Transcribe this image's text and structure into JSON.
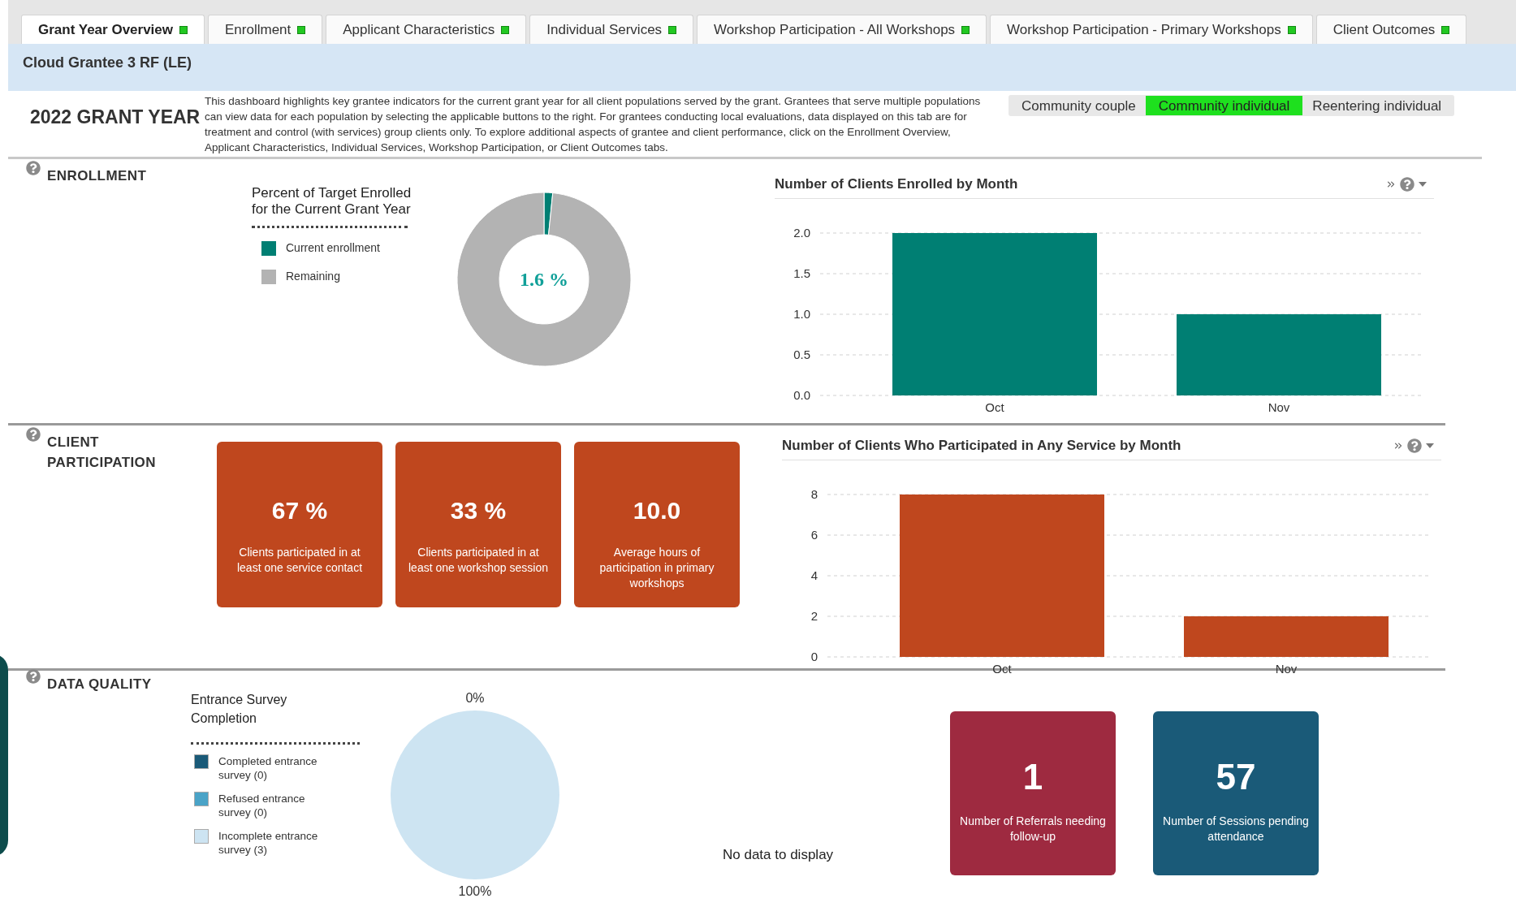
{
  "tabs": [
    {
      "label": "Grant Year Overview",
      "selected": true
    },
    {
      "label": "Enrollment",
      "selected": false
    },
    {
      "label": "Applicant Characteristics",
      "selected": false
    },
    {
      "label": "Individual Services",
      "selected": false
    },
    {
      "label": "Workshop Participation - All Workshops",
      "selected": false
    },
    {
      "label": "Workshop Participation - Primary Workshops",
      "selected": false
    },
    {
      "label": "Client Outcomes",
      "selected": false
    }
  ],
  "grantee": "Cloud Grantee 3 RF (LE)",
  "header": {
    "title": "2022 GRANT YEAR",
    "description": "This dashboard highlights key grantee indicators for the current grant year for all client populations served by the grant. Grantees that serve multiple populations can view data for each population by selecting the applicable buttons to the right. For grantees conducting local evaluations, data displayed on this tab are for treatment and control (with services) group clients only. To explore additional aspects of grantee and client performance, click on the Enrollment Overview, Applicant Characteristics, Individual Services, Workshop Participation, or Client Outcomes tabs."
  },
  "populations": [
    {
      "label": "Community couple",
      "selected": false
    },
    {
      "label": "Community individual",
      "selected": true
    },
    {
      "label": "Reentering individual",
      "selected": false
    }
  ],
  "enrollment": {
    "title": "ENROLLMENT",
    "donut_title": "Percent of Target Enrolled for the Current Grant Year",
    "center_label": "1.6 %",
    "legend": [
      {
        "color": "#007f73"
      },
      {
        "color": "#b3b3b3"
      }
    ],
    "chart_data": {
      "type": "donut",
      "categories": [
        "Current enrollment",
        "Remaining"
      ],
      "values": [
        1.6,
        98.4
      ]
    },
    "bar_panel": {
      "title": "Number of Clients Enrolled by Month",
      "chart_data": {
        "type": "bar",
        "categories": [
          "Oct",
          "Nov"
        ],
        "series": [
          {
            "color": "#007f73",
            "values": [
              2,
              1
            ]
          }
        ],
        "grid": true,
        "ylim": [
          0,
          2
        ],
        "yticks": [
          {
            "value": 0,
            "label": "0.0"
          },
          {
            "value": 0.5,
            "label": "0.5"
          },
          {
            "value": 1,
            "label": "1.0"
          },
          {
            "value": 1.5,
            "label": "1.5"
          },
          {
            "value": 2,
            "label": "2.0"
          }
        ]
      }
    }
  },
  "participation": {
    "title": "CLIENT PARTICIPATION",
    "cards": [
      {
        "value": "67 %",
        "label": "Clients participated in at least one service contact"
      },
      {
        "value": "33 %",
        "label": "Clients participated in at least one workshop session"
      },
      {
        "value": "10.0",
        "label": "Average hours of participation in primary workshops"
      }
    ],
    "bar_panel": {
      "title": "Number of Clients Who Participated in Any Service by Month",
      "chart_data": {
        "type": "bar",
        "categories": [
          "Oct",
          "Nov"
        ],
        "series": [
          {
            "color": "#bf471e",
            "values": [
              8,
              2
            ]
          }
        ],
        "grid": true,
        "ylim": [
          0,
          8
        ],
        "yticks": [
          0,
          2,
          4,
          6,
          8
        ]
      }
    }
  },
  "data_quality": {
    "title": "DATA QUALITY",
    "pie_title": "Entrance Survey Completion",
    "legend": [
      {
        "color": "#1a5a78"
      },
      {
        "color": "#4aa3c7"
      },
      {
        "color": "#cde4f2"
      }
    ],
    "chart_data": {
      "type": "pie",
      "categories": [
        "Completed entrance survey (0)",
        "Refused entrance survey (0)",
        "Incomplete entrance survey (3)"
      ],
      "values": [
        0,
        0,
        100
      ]
    },
    "pie_top_label": "0%",
    "pie_bottom_label": "100%",
    "empty_message": "No data to display",
    "cards": [
      {
        "value": "1",
        "label": "Number of Referrals needing follow-up",
        "color": "#9e2a40"
      },
      {
        "value": "57",
        "label": "Number of Sessions pending attendance",
        "color": "#1a5a78"
      }
    ]
  }
}
